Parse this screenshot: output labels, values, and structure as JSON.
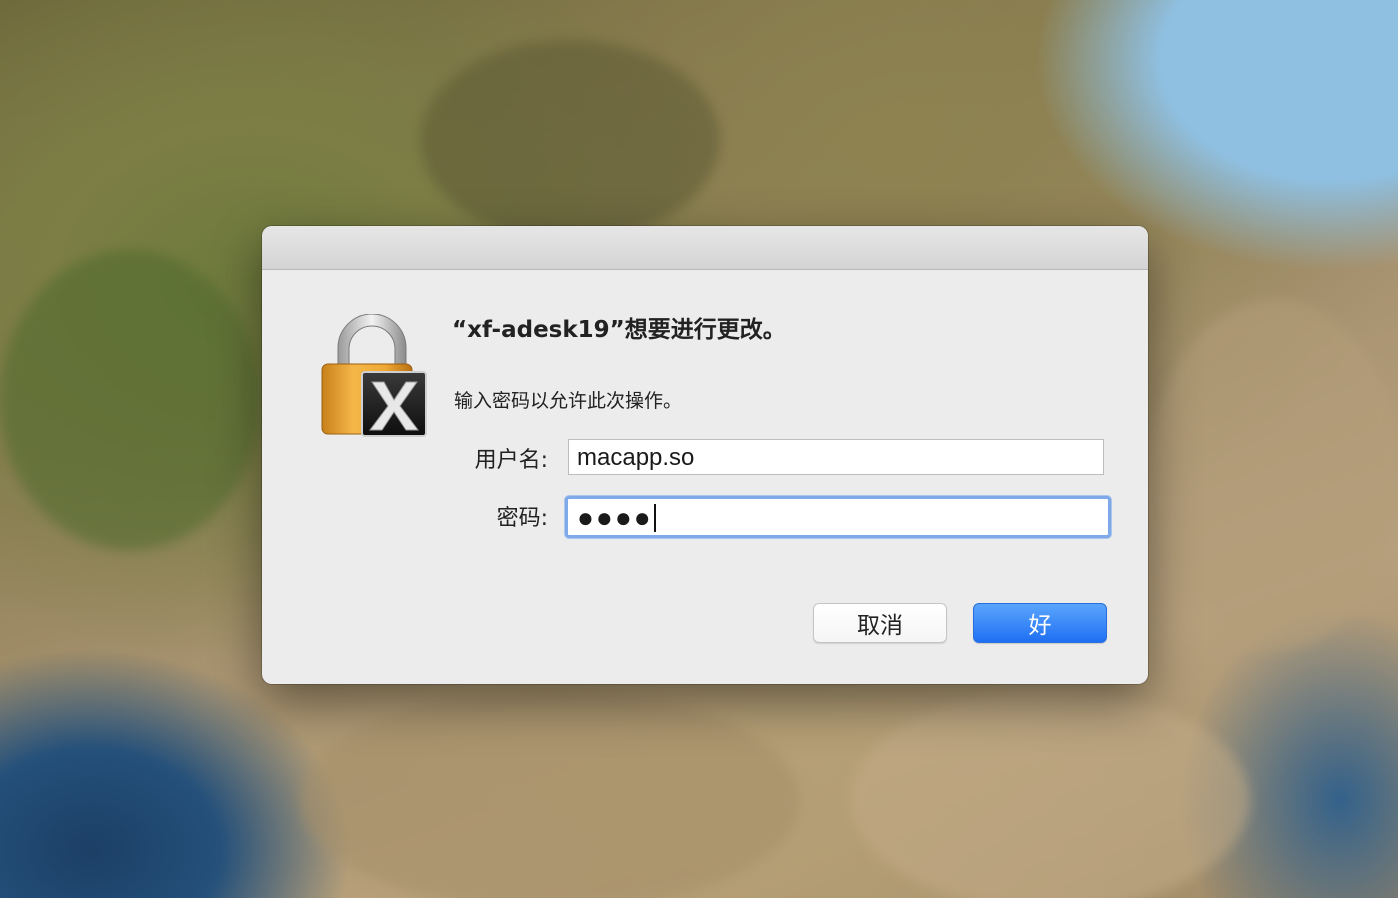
{
  "dialog": {
    "title": "“xf-adesk19”想要进行更改。",
    "subtitle": "输入密码以允许此次操作。",
    "icon": "lock-with-app-badge-icon",
    "username_label": "用户名:",
    "username_value": "macapp.so",
    "password_label": "密码:",
    "password_mask": "●●●●",
    "cancel_label": "取消",
    "ok_label": "好"
  },
  "colors": {
    "accent": "#1f6ff4",
    "focus_ring": "#7fa9e8",
    "dialog_bg": "#ececec"
  }
}
